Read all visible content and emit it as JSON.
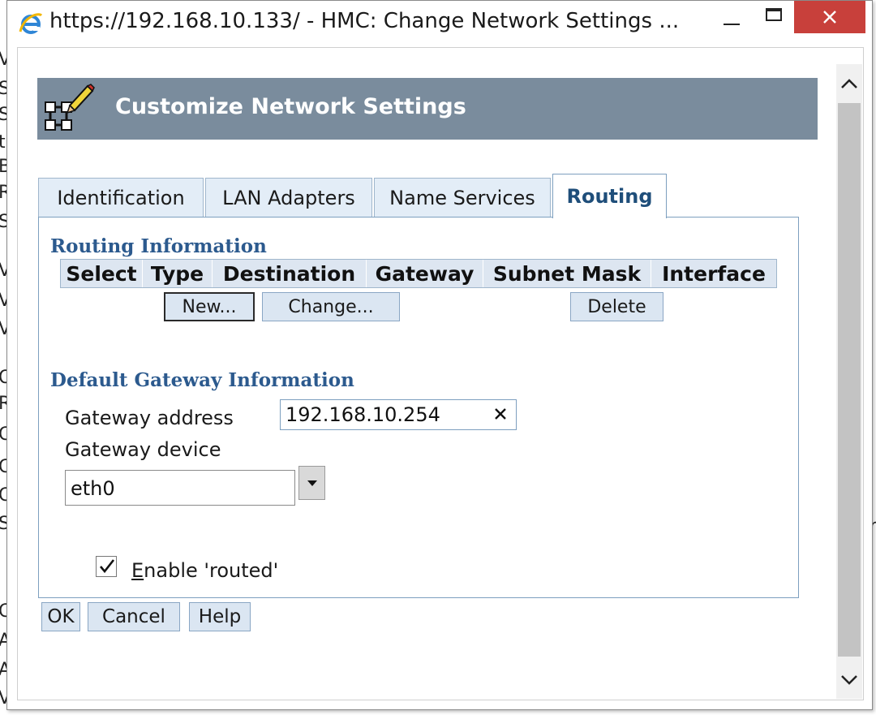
{
  "window": {
    "title": "https://192.168.10.133/ - HMC: Change Network Settings ...",
    "browser_icon": "internet-explorer-icon",
    "controls": {
      "minimize": "minimize-icon",
      "maximize": "maximize-icon",
      "close": "close-icon"
    },
    "close_color": "#c8403b"
  },
  "background_chars": [
    "V",
    "S",
    "S",
    "t",
    "B",
    "R",
    "S",
    "V",
    "V",
    "V",
    "O",
    "R",
    "C",
    "C",
    "C",
    "S",
    "C",
    "A",
    "A",
    "V"
  ],
  "background_right_char": "r",
  "header": {
    "title": "Customize Network Settings",
    "icon": "network-settings-icon",
    "banner_color": "#7a8c9d"
  },
  "tabs": [
    {
      "label": "Identification",
      "active": false
    },
    {
      "label": "LAN Adapters",
      "active": false
    },
    {
      "label": "Name Services",
      "active": false
    },
    {
      "label": "Routing",
      "active": true
    }
  ],
  "routing": {
    "section_title": "Routing Information",
    "columns": [
      "Select",
      "Type",
      "Destination",
      "Gateway",
      "Subnet Mask",
      "Interface"
    ],
    "buttons": {
      "new": "New...",
      "change": "Change...",
      "delete": "Delete"
    }
  },
  "default_gateway": {
    "section_title": "Default Gateway Information",
    "address_label": "Gateway address",
    "address_value": "192.168.10.254",
    "device_label": "Gateway device",
    "device_value": "eth0"
  },
  "routed": {
    "label_first": "E",
    "label_rest": "nable 'routed'",
    "checked": true
  },
  "dialog_buttons": {
    "ok": "OK",
    "cancel": "Cancel",
    "help": "Help"
  },
  "accent_color": "#2c5a8e"
}
